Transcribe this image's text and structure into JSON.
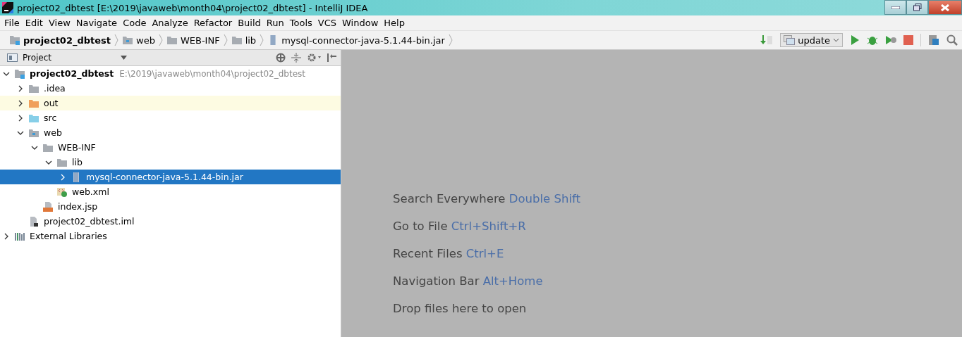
{
  "window": {
    "title": "project02_dbtest [E:\\2019\\javaweb\\month04\\project02_dbtest] - IntelliJ IDEA"
  },
  "menu": [
    "File",
    "Edit",
    "View",
    "Navigate",
    "Code",
    "Analyze",
    "Refactor",
    "Build",
    "Run",
    "Tools",
    "VCS",
    "Window",
    "Help"
  ],
  "breadcrumbs": [
    {
      "label": "project02_dbtest",
      "kind": "module"
    },
    {
      "label": "web",
      "kind": "folder-web"
    },
    {
      "label": "WEB-INF",
      "kind": "folder"
    },
    {
      "label": "lib",
      "kind": "folder"
    },
    {
      "label": "mysql-connector-java-5.1.44-bin.jar",
      "kind": "jar"
    }
  ],
  "run_config": {
    "label": "update"
  },
  "project_panel": {
    "title": "Project",
    "tree": [
      {
        "label": "project02_dbtest",
        "path": "E:\\2019\\javaweb\\month04\\project02_dbtest",
        "kind": "module",
        "expanded": true,
        "selected": false,
        "highlighted": false,
        "children": [
          {
            "label": ".idea",
            "kind": "folder",
            "expanded": false,
            "selected": false,
            "highlighted": false
          },
          {
            "label": "out",
            "kind": "folder-excluded",
            "expanded": false,
            "selected": false,
            "highlighted": true
          },
          {
            "label": "src",
            "kind": "folder-source",
            "expanded": false,
            "selected": false,
            "highlighted": false
          },
          {
            "label": "web",
            "kind": "folder-web",
            "expanded": true,
            "selected": false,
            "highlighted": false,
            "children": [
              {
                "label": "WEB-INF",
                "kind": "folder",
                "expanded": true,
                "selected": false,
                "highlighted": false,
                "children": [
                  {
                    "label": "lib",
                    "kind": "folder",
                    "expanded": true,
                    "selected": false,
                    "highlighted": false,
                    "children": [
                      {
                        "label": "mysql-connector-java-5.1.44-bin.jar",
                        "kind": "jar",
                        "expanded": false,
                        "selected": true,
                        "highlighted": false
                      }
                    ]
                  },
                  {
                    "label": "web.xml",
                    "kind": "xml",
                    "selected": false,
                    "highlighted": false
                  }
                ]
              },
              {
                "label": "index.jsp",
                "kind": "jsp",
                "selected": false,
                "highlighted": false
              }
            ]
          },
          {
            "label": "project02_dbtest.iml",
            "kind": "iml",
            "selected": false,
            "highlighted": false
          }
        ]
      },
      {
        "label": "External Libraries",
        "kind": "libraries",
        "expanded": false,
        "selected": false,
        "highlighted": false
      }
    ]
  },
  "editor_hints": [
    {
      "text": "Search Everywhere",
      "shortcut": "Double Shift"
    },
    {
      "text": "Go to File",
      "shortcut": "Ctrl+Shift+R"
    },
    {
      "text": "Recent Files",
      "shortcut": "Ctrl+E"
    },
    {
      "text": "Navigation Bar",
      "shortcut": "Alt+Home"
    },
    {
      "text": "Drop files here to open"
    }
  ]
}
